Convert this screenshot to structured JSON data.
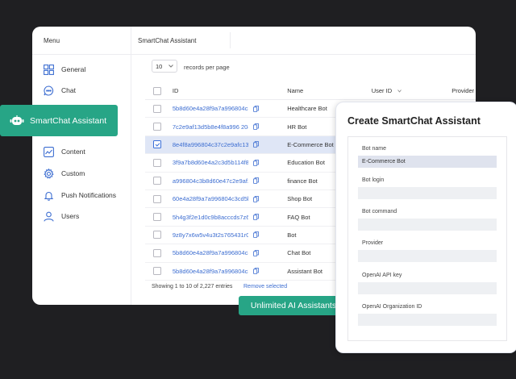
{
  "sidebar": {
    "title": "Menu",
    "items": [
      {
        "label": "General",
        "icon": "grid-icon"
      },
      {
        "label": "Chat",
        "icon": "chat-bubble-icon"
      },
      {
        "label": "Content",
        "icon": "chart-icon"
      },
      {
        "label": "Custom",
        "icon": "gear-icon"
      },
      {
        "label": "Push Notifications",
        "icon": "bell-icon"
      },
      {
        "label": "Users",
        "icon": "user-icon"
      }
    ]
  },
  "header": {
    "title": "SmartChat Assistant"
  },
  "records": {
    "value": "10",
    "label": "records per page"
  },
  "table": {
    "columns": {
      "id": "ID",
      "name": "Name",
      "user_id": "User ID",
      "provider": "Provider"
    },
    "rows": [
      {
        "id": "5b8d60e4a28f9a7a996804c3",
        "name": "Healthcare Bot",
        "selected": false
      },
      {
        "id": "7c2e9af13d5b8e4f8a996 204",
        "name": "HR Bot",
        "selected": false
      },
      {
        "id": "8e4f8a996804c37c2e9afc13d",
        "name": "E-Commerce Bot",
        "selected": true
      },
      {
        "id": "3f9a7b8d60e4a2c3d5b114f8",
        "name": "Education Bot",
        "selected": false
      },
      {
        "id": "a996804c3b8d60e47c2e9af1",
        "name": "finance Bot",
        "selected": false
      },
      {
        "id": "60e4a28f9a7a996804c3cd5b",
        "name": "Shop Bot",
        "selected": false
      },
      {
        "id": "5h4g3f2e1d0c9b8acccds7z6y",
        "name": "FAQ Bot",
        "selected": false
      },
      {
        "id": "9z8y7x6w5v4u3t2s765431r0q",
        "name": "Bot",
        "selected": false
      },
      {
        "id": "5b8d60e4a28f9a7a996804c3",
        "name": "Chat Bot",
        "selected": false
      },
      {
        "id": "5b8d60e4a28f9a7a996804c3",
        "name": "Assistant Bot",
        "selected": false
      }
    ]
  },
  "footer": {
    "count": "Showing 1 to 10 of 2,227 entries",
    "remove": "Remove selected"
  },
  "badges": {
    "smartchat": "SmartChat Assistant",
    "unlimited": "Unlimited AI Assistants"
  },
  "panel": {
    "title": "Create SmartChat Assistant",
    "fields": [
      {
        "label": "Bot name",
        "value": "E-Commerce Bot"
      },
      {
        "label": "Bot login",
        "value": ""
      },
      {
        "label": "Bot command",
        "value": ""
      },
      {
        "label": "Provider",
        "value": ""
      },
      {
        "label": "OpenAI API key",
        "value": ""
      },
      {
        "label": "OpenAI Organization ID",
        "value": ""
      }
    ]
  },
  "colors": {
    "accent": "#27a586",
    "link": "#3d6ed1",
    "selected_row": "#dfe6f6",
    "background": "#1f1f22"
  }
}
